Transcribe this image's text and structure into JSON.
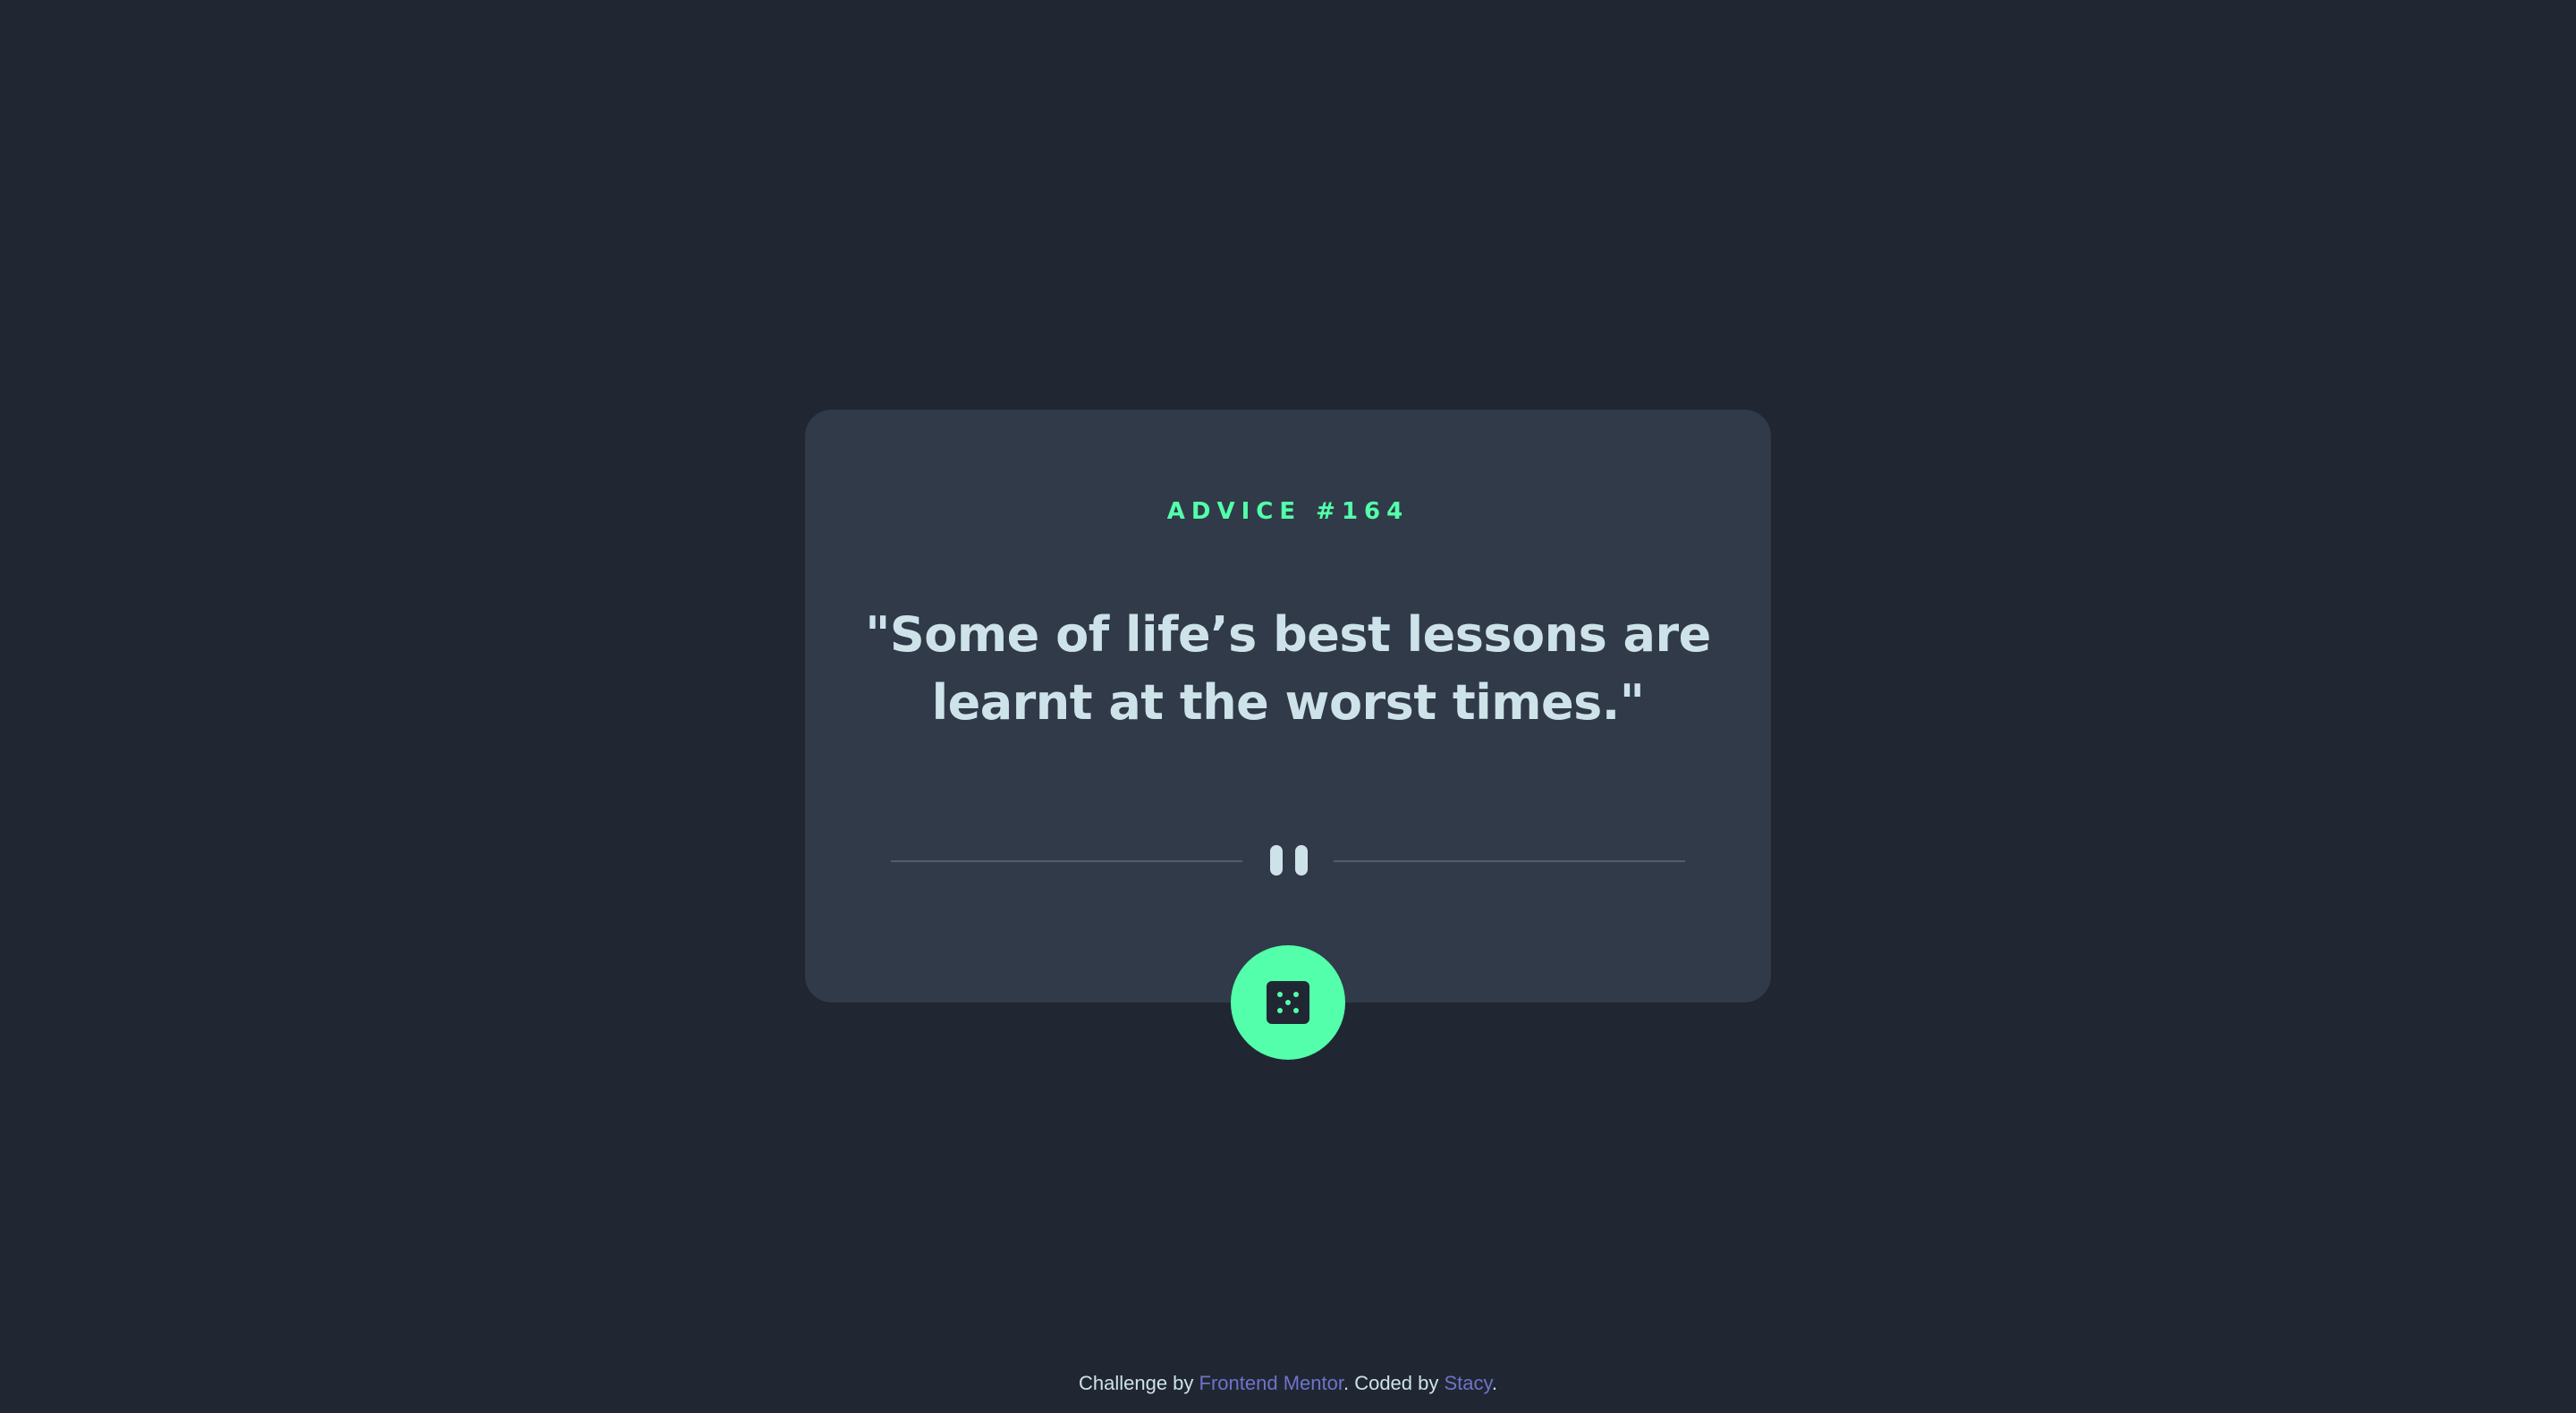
{
  "advice": {
    "id_label": "ADVICE #164",
    "quote": "\"Some of life’s best lessons are learnt at the worst times.\""
  },
  "divider": {
    "icon": "pause-icon"
  },
  "button": {
    "icon": "dice-icon"
  },
  "footer": {
    "prefix": "Challenge by ",
    "challenge_link": "Frontend Mentor",
    "middle": ". Coded by ",
    "author_link": "Stacy",
    "suffix": "."
  },
  "colors": {
    "background": "#202733",
    "card": "#313a48",
    "accent": "#53ffaa",
    "text": "#cee3e9",
    "divider": "#4f5d74",
    "link": "#6e73c9"
  }
}
